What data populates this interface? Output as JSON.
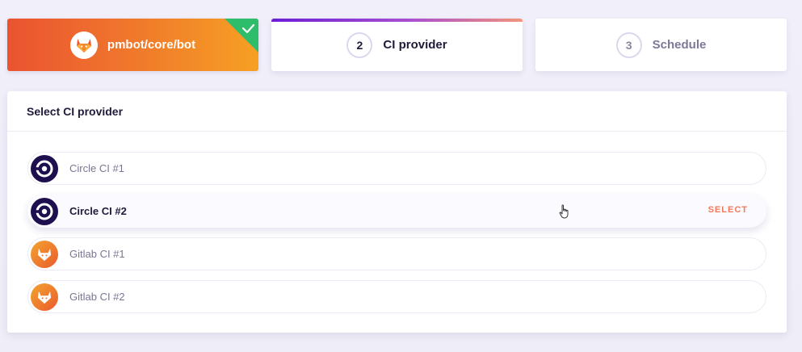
{
  "steps": [
    {
      "label": "pmbot/core/bot",
      "state": "completed",
      "icon": "gitlab-fox-icon"
    },
    {
      "number": "2",
      "label": "CI provider",
      "state": "active"
    },
    {
      "number": "3",
      "label": "Schedule",
      "state": "pending"
    }
  ],
  "panel": {
    "title": "Select CI provider"
  },
  "providers": [
    {
      "label": "Circle CI #1",
      "icon": "circleci-icon"
    },
    {
      "label": "Circle CI #2",
      "icon": "circleci-icon",
      "action": "SELECT"
    },
    {
      "label": "Gitlab CI #1",
      "icon": "gitlab-fox-icon"
    },
    {
      "label": "Gitlab CI #2",
      "icon": "gitlab-fox-icon"
    }
  ],
  "colors": {
    "accent_orange": "#f07a5a",
    "completed_green": "#2ebd6b",
    "circleci_dark": "#1e0f4f"
  }
}
